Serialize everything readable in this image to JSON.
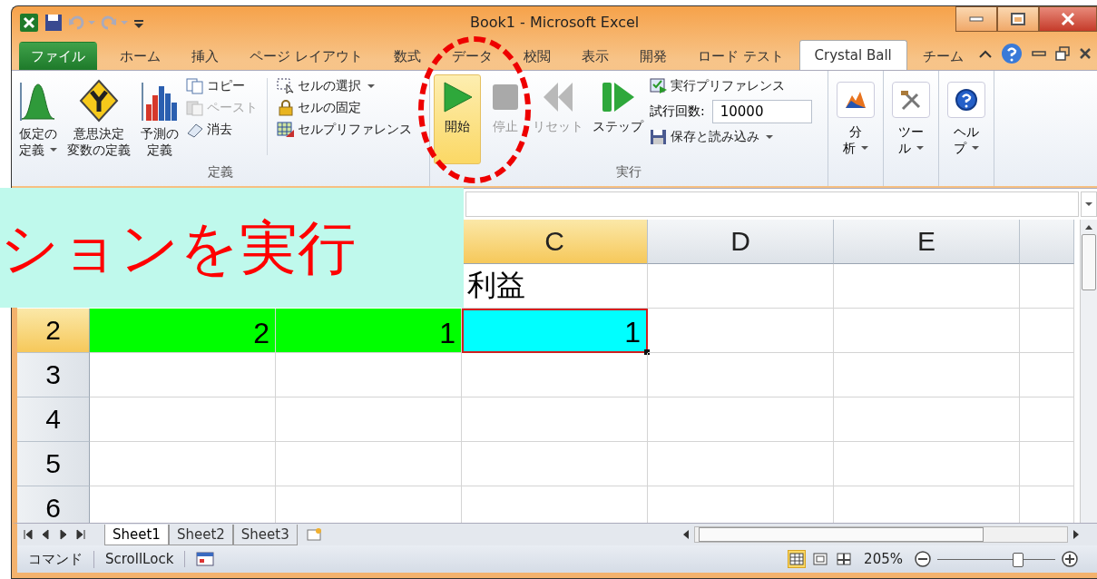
{
  "window": {
    "title": "Book1  -  Microsoft Excel"
  },
  "ribbon_tabs": [
    {
      "label": "ファイル",
      "kind": "file",
      "selected": false
    },
    {
      "label": "ホーム",
      "kind": "tab",
      "selected": false
    },
    {
      "label": "挿入",
      "kind": "tab",
      "selected": false
    },
    {
      "label": "ページ レイアウト",
      "kind": "tab",
      "selected": false
    },
    {
      "label": "数式",
      "kind": "tab",
      "selected": false
    },
    {
      "label": "データ",
      "kind": "tab",
      "selected": false
    },
    {
      "label": "校閲",
      "kind": "tab",
      "selected": false
    },
    {
      "label": "表示",
      "kind": "tab",
      "selected": false
    },
    {
      "label": "開発",
      "kind": "tab",
      "selected": false
    },
    {
      "label": "ロード テスト",
      "kind": "tab",
      "selected": false
    },
    {
      "label": "Crystal Ball",
      "kind": "tab",
      "selected": true
    },
    {
      "label": "チーム",
      "kind": "tab",
      "selected": false
    }
  ],
  "define_group": {
    "label": "定義",
    "large_buttons": [
      {
        "lines": [
          "仮定の",
          "定義"
        ],
        "kind": "bell",
        "dropdown": true
      },
      {
        "lines": [
          "意思決定",
          "変数の定義"
        ],
        "kind": "decision",
        "dropdown": false
      },
      {
        "lines": [
          "予測の",
          "定義"
        ],
        "kind": "forecast",
        "dropdown": false
      }
    ],
    "small_buttons": [
      {
        "label": "コピー",
        "kind": "copy",
        "disabled": false
      },
      {
        "label": "ペースト",
        "kind": "paste",
        "disabled": true
      },
      {
        "label": "消去",
        "kind": "clear",
        "disabled": false
      }
    ],
    "cell_buttons": [
      {
        "label": "セルの選択",
        "kind": "select",
        "dropdown": true
      },
      {
        "label": "セルの固定",
        "kind": "lock",
        "dropdown": false
      },
      {
        "label": "セルプリファレンス",
        "kind": "cellpref",
        "dropdown": false
      }
    ]
  },
  "run_group": {
    "label": "実行",
    "buttons": [
      {
        "label": "開始",
        "kind": "play",
        "selected": true,
        "disabled": false
      },
      {
        "label": "停止",
        "kind": "stop",
        "selected": false,
        "disabled": true
      },
      {
        "label": "リセット",
        "kind": "reset",
        "selected": false,
        "disabled": true
      },
      {
        "label": "ステップ",
        "kind": "step",
        "selected": false,
        "disabled": false
      }
    ],
    "preferences": "実行プリファレンス",
    "trials_label": "試行回数:",
    "trials_value": "10000",
    "save_load": "保存と読み込み"
  },
  "tool_groups": [
    {
      "lines": [
        "分",
        "析"
      ],
      "kind": "analysis"
    },
    {
      "lines": [
        "ツー",
        "ル"
      ],
      "kind": "tools"
    },
    {
      "lines": [
        "ヘル",
        "プ"
      ],
      "kind": "help"
    }
  ],
  "sheet": {
    "columns": [
      {
        "label": "C",
        "selected": true
      },
      {
        "label": "D",
        "selected": false
      },
      {
        "label": "E",
        "selected": false
      }
    ],
    "rows": [
      {
        "cells": [
          {
            "text": "利益",
            "kind": "text",
            "selected": false
          }
        ]
      },
      {
        "header": "2",
        "selected": true,
        "cells": [
          {
            "text": "2",
            "color": "#00ff00",
            "kind": "number",
            "selected": false
          },
          {
            "text": "1",
            "color": "#00ff00",
            "kind": "number",
            "selected": false
          },
          {
            "text": "1",
            "color": "#00ffff",
            "kind": "number",
            "selected": true
          }
        ]
      },
      {
        "header": "3",
        "selected": false
      },
      {
        "header": "4",
        "selected": false
      },
      {
        "header": "5",
        "selected": false
      },
      {
        "header": "6",
        "selected": false
      }
    ]
  },
  "banner": {
    "text": "ションを実行"
  },
  "sheet_tabs": [
    {
      "label": "Sheet1",
      "selected": true
    },
    {
      "label": "Sheet2",
      "selected": false
    },
    {
      "label": "Sheet3",
      "selected": false
    }
  ],
  "status_bar": {
    "items": [
      "コマンド",
      "ScrollLock"
    ],
    "views": [
      {
        "kind": "normal",
        "selected": true
      },
      {
        "kind": "layout",
        "selected": false
      },
      {
        "kind": "pagebreak",
        "selected": false
      }
    ],
    "zoom": "205%",
    "zoom_slider": {
      "level": 0.68
    }
  }
}
